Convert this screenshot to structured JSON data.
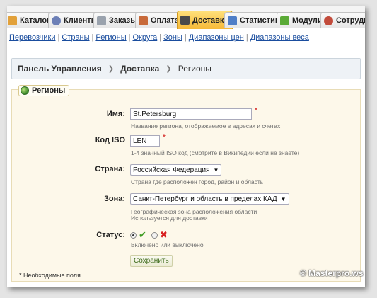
{
  "tabs": [
    {
      "label": "Каталог",
      "icon": "folder-icon",
      "color": "#e2a13a"
    },
    {
      "label": "Клиенты",
      "icon": "users-icon",
      "color": "#6c7fb6"
    },
    {
      "label": "Заказы",
      "icon": "orders-icon",
      "color": "#9aa2ad"
    },
    {
      "label": "Оплата",
      "icon": "payment-icon",
      "color": "#c86a3a"
    },
    {
      "label": "Доставка",
      "icon": "truck-icon",
      "color": "#4a4a4a"
    },
    {
      "label": "Статистика",
      "icon": "stats-icon",
      "color": "#4f7ec7"
    },
    {
      "label": "Модули",
      "icon": "modules-icon",
      "color": "#5aaa36"
    },
    {
      "label": "Сотрудн",
      "icon": "staff-icon",
      "color": "#c24b3b"
    }
  ],
  "active_tab": "Доставка",
  "submenu": [
    "Перевозчики",
    "Страны",
    "Регионы",
    "Округа",
    "Зоны",
    "Диапазоны цен",
    "Диапазоны веса"
  ],
  "breadcrumb": [
    "Панель Управления",
    "Доставка",
    "Регионы"
  ],
  "panel": {
    "legend": "Регионы",
    "name_label": "Имя:",
    "name_value": "St.Petersburg",
    "name_hint": "Название региона, отображаемое в адресах и счетах",
    "iso_label": "Код ISO",
    "iso_value": "LEN",
    "iso_hint": "1-4 значный ISO код (смотрите в Википедии если не знаете)",
    "country_label": "Страна:",
    "country_value": "Российская Федерация",
    "country_hint": "Страна где расположен город, район и область",
    "zone_label": "Зона:",
    "zone_value": "Санкт-Петербург и область в пределах КАД",
    "zone_hint_1": "Географическая зона расположения области",
    "zone_hint_2": "Используется для доставки",
    "status_label": "Статус:",
    "status_hint": "Включено или выключено",
    "status_enabled": true,
    "save_label": "Сохранить",
    "required_star": "*",
    "required_note": "* Необходимые поля"
  },
  "watermark": "© Masterpro.ws",
  "colors": {
    "active_tab": "#f6b938",
    "link": "#1a4d9e",
    "panel_bg": "#fdf8ea",
    "required": "#cc0000",
    "enabled": "#3a9a1e",
    "disabled": "#d82020"
  }
}
